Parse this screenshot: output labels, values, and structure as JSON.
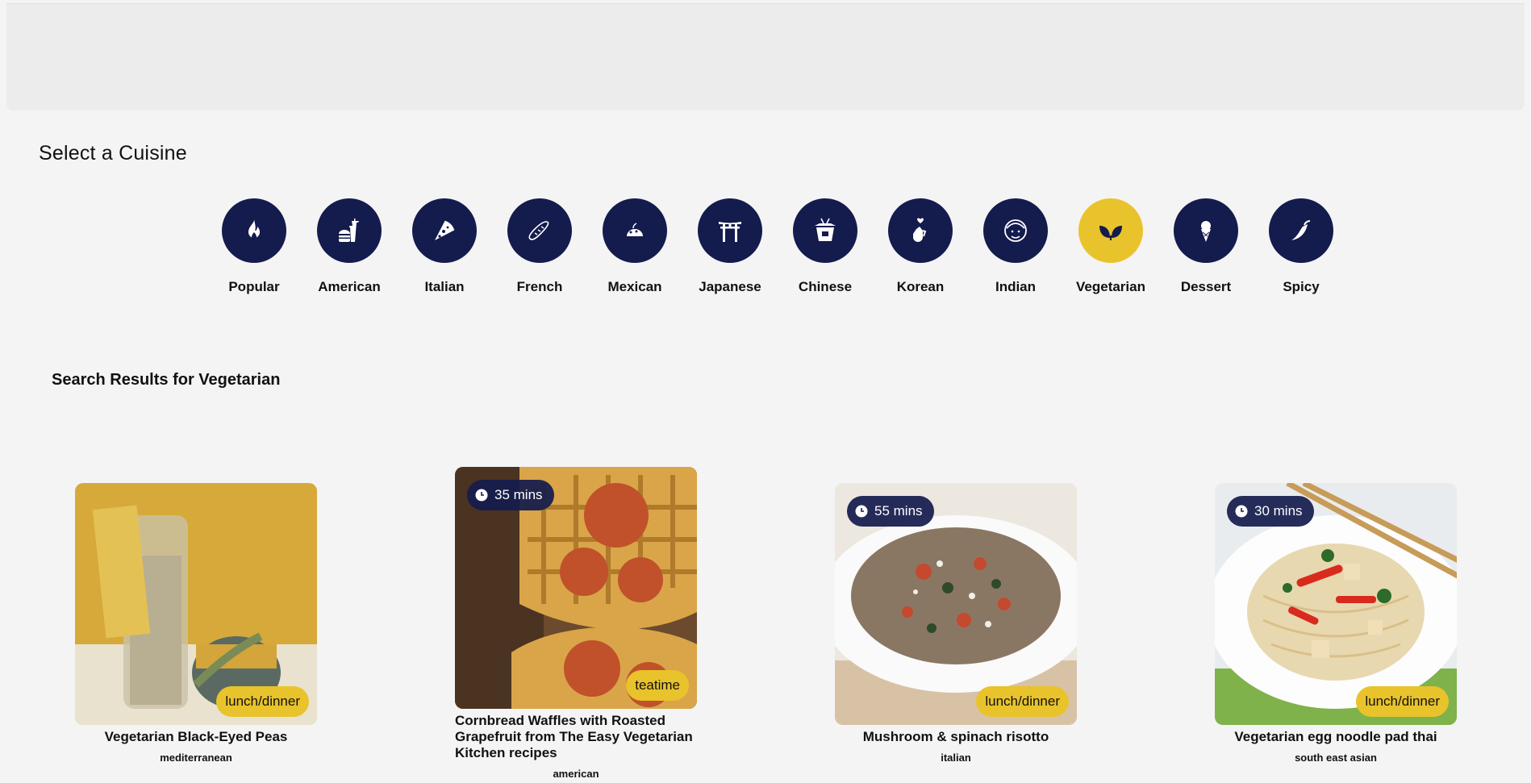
{
  "page": {
    "section_title": "Select a Cuisine",
    "results_title": "Search Results for Vegetarian"
  },
  "colors": {
    "navy": "#141b4d",
    "accent_yellow": "#e8c32b",
    "background": "#f4f4f4"
  },
  "cuisines": [
    {
      "label": "Popular",
      "icon": "flame-icon"
    },
    {
      "label": "American",
      "icon": "burger-drink-icon"
    },
    {
      "label": "Italian",
      "icon": "pizza-icon"
    },
    {
      "label": "French",
      "icon": "baguette-icon"
    },
    {
      "label": "Mexican",
      "icon": "taco-icon"
    },
    {
      "label": "Japanese",
      "icon": "torii-gate-icon"
    },
    {
      "label": "Chinese",
      "icon": "takeout-box-icon"
    },
    {
      "label": "Korean",
      "icon": "finger-heart-icon"
    },
    {
      "label": "Indian",
      "icon": "turban-face-icon"
    },
    {
      "label": "Vegetarian",
      "icon": "leaves-icon",
      "selected": true
    },
    {
      "label": "Dessert",
      "icon": "ice-cream-icon"
    },
    {
      "label": "Spicy",
      "icon": "chili-pepper-icon"
    }
  ],
  "results": [
    {
      "title": "Vegetarian Black-Eyed Peas",
      "cuisine": "mediterranean",
      "meal": "lunch/dinner"
    },
    {
      "title": "Cornbread Waffles with Roasted Grapefruit from The Easy Vegetarian Kitchen recipes",
      "cuisine": "american",
      "meal": "teatime",
      "time": "35 mins"
    },
    {
      "title": "Mushroom & spinach risotto",
      "cuisine": "italian",
      "meal": "lunch/dinner",
      "time": "55 mins"
    },
    {
      "title": "Vegetarian egg noodle pad thai",
      "cuisine": "south east asian",
      "meal": "lunch/dinner",
      "time": "30 mins"
    }
  ]
}
